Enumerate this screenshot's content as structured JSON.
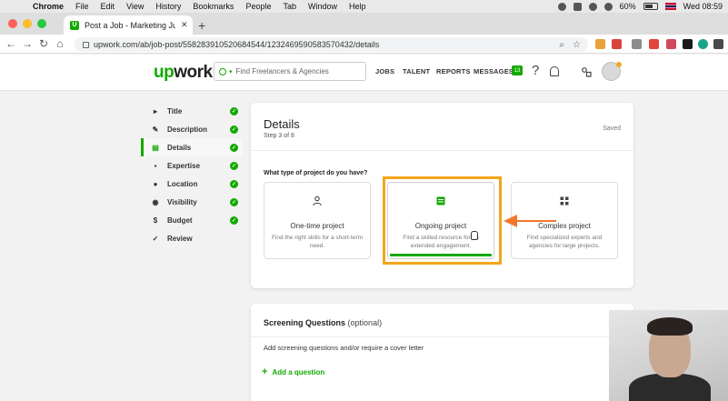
{
  "menubar": {
    "app": "Chrome",
    "items": [
      "File",
      "Edit",
      "View",
      "History",
      "Bookmarks",
      "People",
      "Tab",
      "Window",
      "Help"
    ],
    "battery": "60%",
    "clock": "Wed 08:59"
  },
  "browser": {
    "tab_title": "Post a Job - Marketing Jules",
    "url": "upwork.com/ab/job-post/55828391052068454​4/1232469590583570432/details"
  },
  "header": {
    "logo": "upwork",
    "search_placeholder": "Find Freelancers & Agencies",
    "nav": [
      "JOBS",
      "TALENT",
      "REPORTS",
      "MESSAGES"
    ],
    "messages_badge": "13"
  },
  "sidebar": {
    "items": [
      {
        "label": "Title",
        "icon": "title-icon",
        "done": true
      },
      {
        "label": "Description",
        "icon": "edit-icon",
        "done": true
      },
      {
        "label": "Details",
        "icon": "details-icon",
        "done": true,
        "active": true
      },
      {
        "label": "Expertise",
        "icon": "expertise-icon",
        "done": true
      },
      {
        "label": "Location",
        "icon": "location-icon",
        "done": true
      },
      {
        "label": "Visibility",
        "icon": "visibility-icon",
        "done": true
      },
      {
        "label": "Budget",
        "icon": "dollar-icon",
        "done": true
      },
      {
        "label": "Review",
        "icon": "checkmark-icon",
        "done": false
      }
    ]
  },
  "details": {
    "title": "Details",
    "step": "Step 3 of 8",
    "saved": "Saved",
    "question": "What type of project do you have?",
    "options": [
      {
        "title": "One-time project",
        "desc": "Find the right skills for a short-term need."
      },
      {
        "title": "Ongoing project",
        "desc": "Find a skilled resource for an extended engagement."
      },
      {
        "title": "Complex project",
        "desc": "Find specialized experts and agencies for large projects."
      }
    ],
    "selected_option": "Ongoing project"
  },
  "screening": {
    "title": "Screening Questions",
    "optional": "(optional)",
    "desc": "Add screening questions and/or require a cover letter",
    "add_label": "Add a question"
  },
  "colors": {
    "brand_green": "#14a800",
    "highlight": "#f2a51a",
    "arrow": "#f4772c"
  }
}
